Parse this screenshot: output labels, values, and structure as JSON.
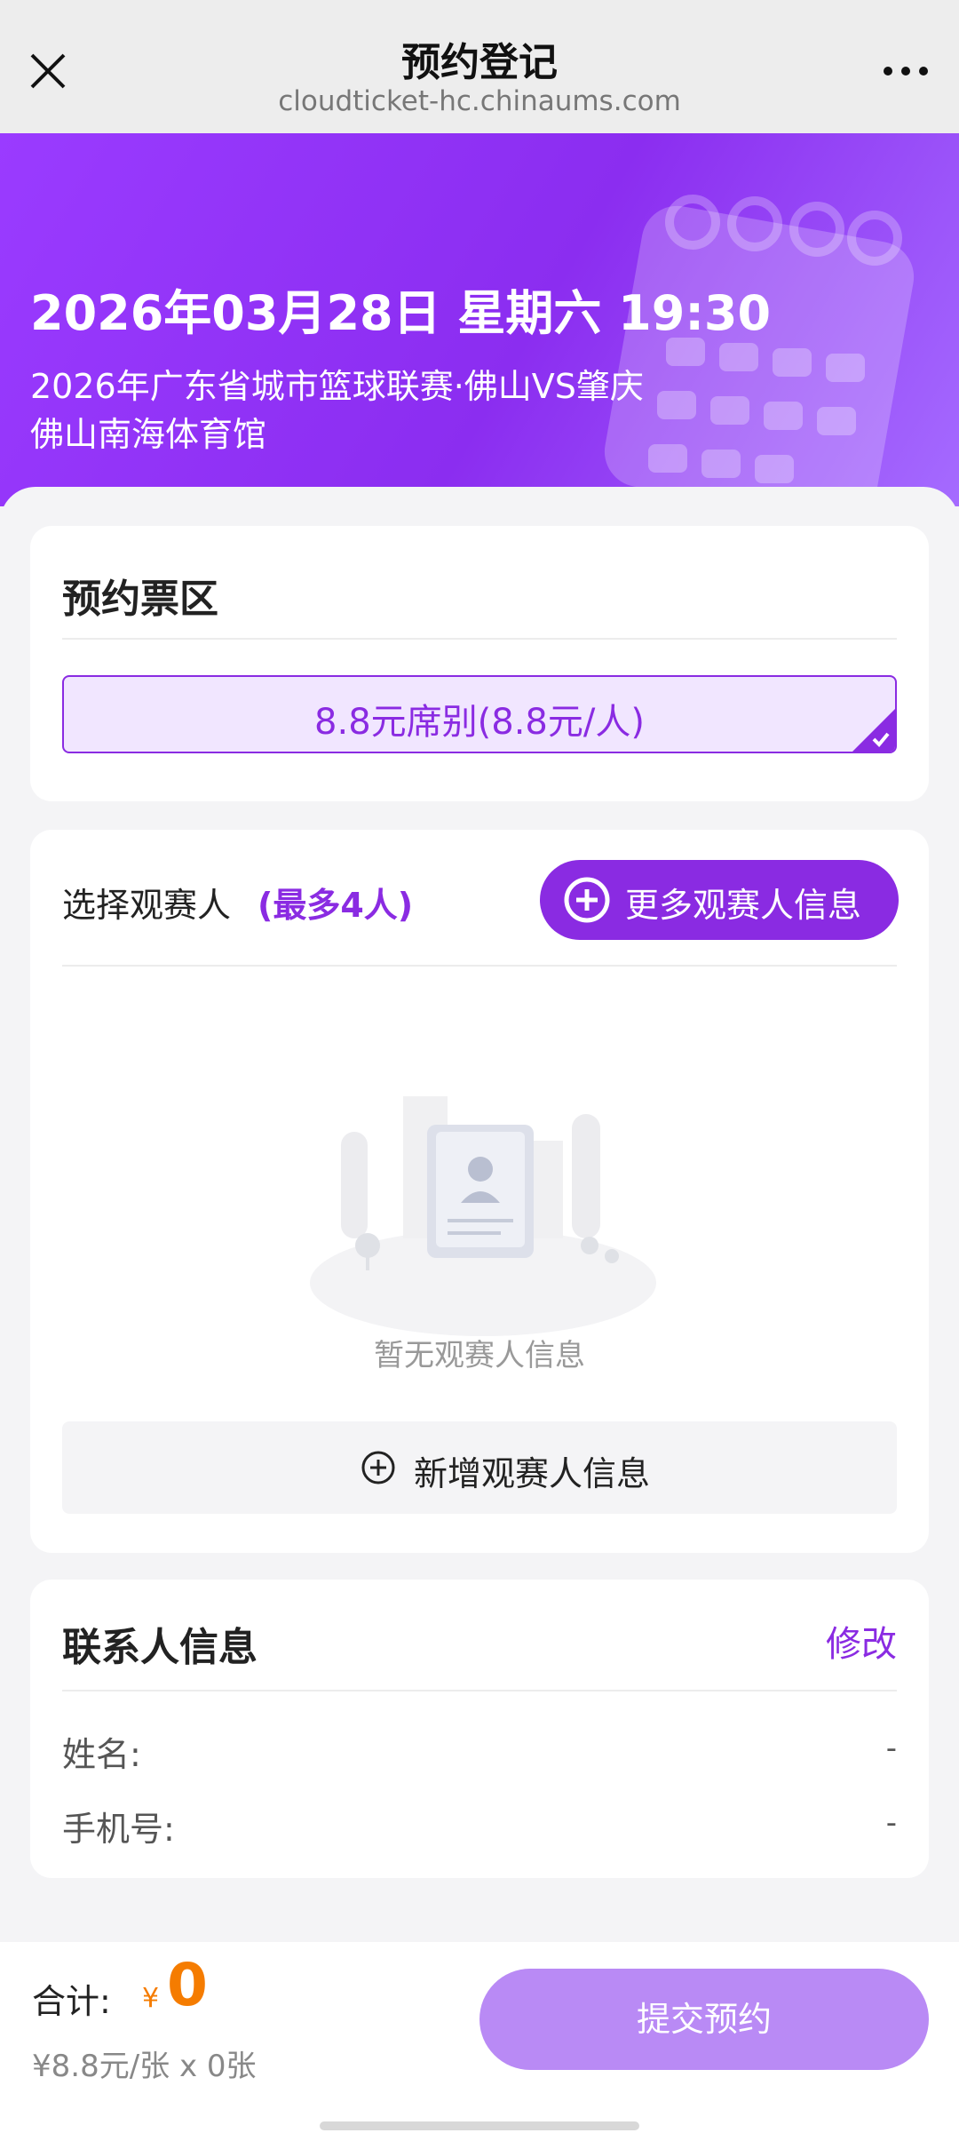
{
  "navbar": {
    "title": "预约登记",
    "url": "cloudticket-hc.chinaums.com",
    "close_icon": "close-icon",
    "more_icon": "more-horizontal-icon"
  },
  "hero": {
    "datetime": "2026年03月28日 星期六 19:30",
    "event": "2026年广东省城市篮球联赛·佛山VS肇庆",
    "venue": "佛山南海体育馆"
  },
  "ticket_zone": {
    "title": "预约票区",
    "option_label": "8.8元席别(8.8元/人)",
    "selected": true
  },
  "viewers": {
    "title": "选择观赛人",
    "max_note": "(最多4人)",
    "more_button": "更多观赛人信息",
    "empty_text": "暂无观赛人信息",
    "add_button": "新增观赛人信息"
  },
  "contact": {
    "title": "联系人信息",
    "edit_label": "修改",
    "fields": [
      {
        "label": "姓名:",
        "value": "-"
      },
      {
        "label": "手机号:",
        "value": "-"
      }
    ]
  },
  "summary": {
    "total_label": "合计:",
    "currency_symbol": "¥",
    "total_value": "0",
    "unit_desc": "¥8.8元/张 x 0张",
    "submit_label": "提交预约"
  },
  "colors": {
    "accent": "#8a2be2",
    "price": "#f57c00",
    "submit_disabled": "#b98af5"
  }
}
